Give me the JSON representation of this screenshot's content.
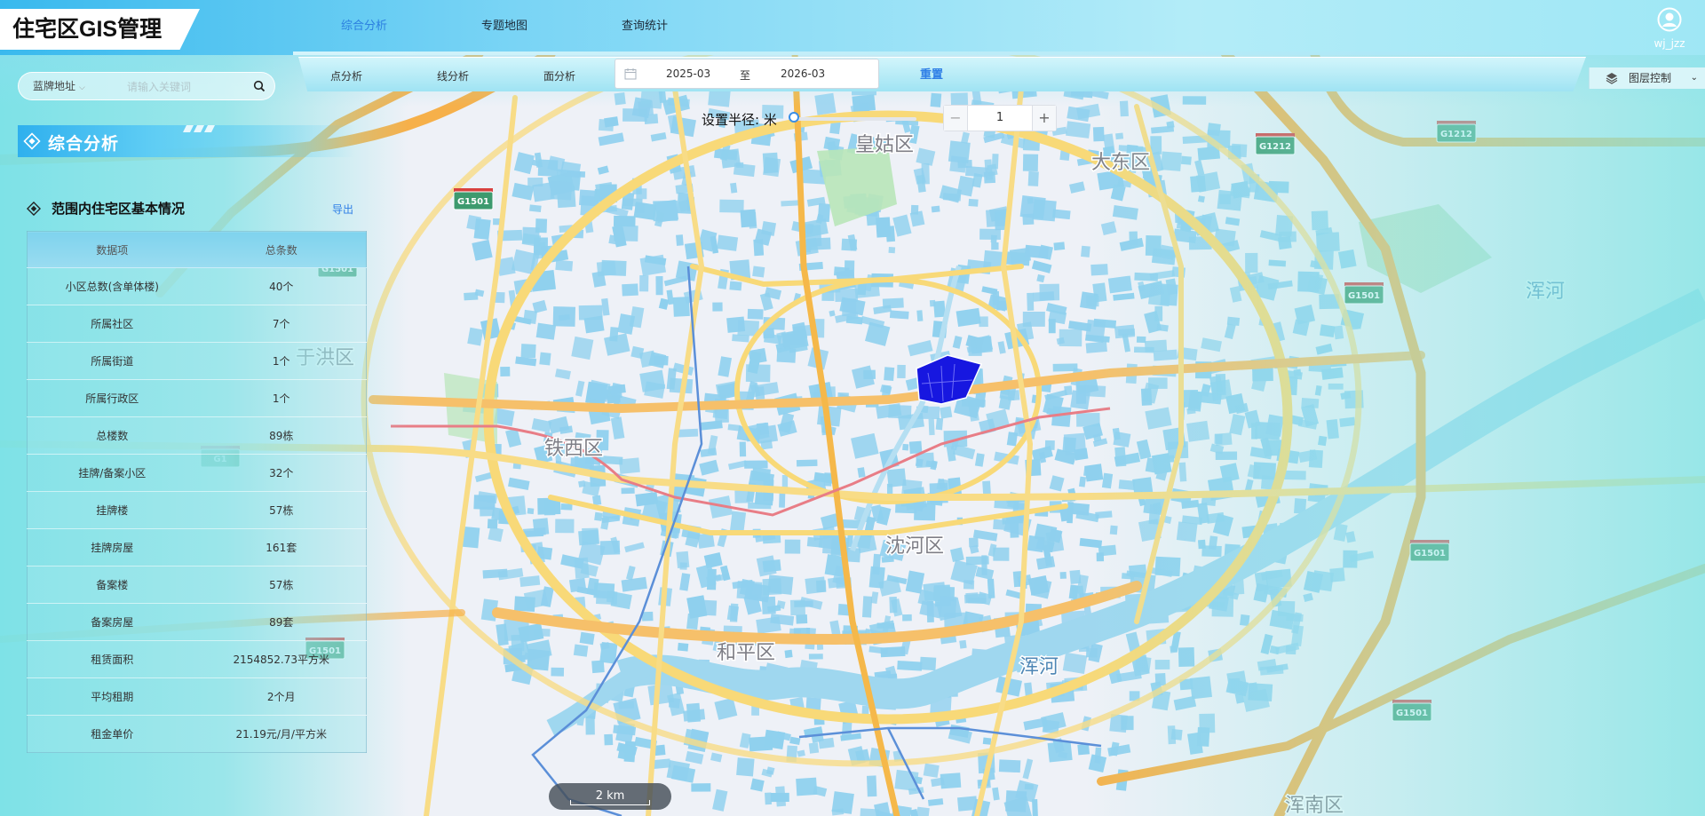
{
  "app": {
    "title": "住宅区GIS管理"
  },
  "header": {
    "tabs": [
      {
        "label": "综合分析",
        "active": true
      },
      {
        "label": "专题地图",
        "active": false
      },
      {
        "label": "查询统计",
        "active": false
      }
    ],
    "user": {
      "name": "wj_jzz",
      "icon": "user-icon"
    }
  },
  "toolbar": {
    "buttons": [
      {
        "label": "点分析"
      },
      {
        "label": "线分析"
      },
      {
        "label": "面分析"
      }
    ],
    "date_range": {
      "start": "2025-03",
      "separator": "至",
      "end": "2026-03",
      "icon": "calendar-icon"
    },
    "reset_label": "重置"
  },
  "layer_control": {
    "label": "图层控制",
    "icon": "layers-icon"
  },
  "search": {
    "type_selected": "蓝牌地址",
    "placeholder": "请输入关键词",
    "icon": "search-icon"
  },
  "radius": {
    "label": "设置半径: 米",
    "slider_value": 0,
    "value": "1",
    "minus": "−",
    "plus": "+"
  },
  "panel": {
    "title": "综合分析",
    "section_title": "范围内住宅区基本情况",
    "export_label": "导出",
    "table": {
      "headers": [
        "数据项",
        "总条数"
      ],
      "rows": [
        [
          "小区总数(含单体楼)",
          "40个"
        ],
        [
          "所属社区",
          "7个"
        ],
        [
          "所属街道",
          "1个"
        ],
        [
          "所属行政区",
          "1个"
        ],
        [
          "总楼数",
          "89栋"
        ],
        [
          "挂牌/备案小区",
          "32个"
        ],
        [
          "挂牌楼",
          "57栋"
        ],
        [
          "挂牌房屋",
          "161套"
        ],
        [
          "备案楼",
          "57栋"
        ],
        [
          "备案房屋",
          "89套"
        ],
        [
          "租赁面积",
          "2154852.73平方米"
        ],
        [
          "平均租期",
          "2个月"
        ],
        [
          "租金单价",
          "21.19元/月/平方米"
        ]
      ]
    }
  },
  "map": {
    "labels": [
      "皇姑区",
      "大东区",
      "于洪区",
      "铁西区",
      "沈河区",
      "和平区",
      "浑河",
      "浑河",
      "浑南区"
    ],
    "road_shields": [
      "G1501",
      "G1212",
      "G1212",
      "G1501",
      "G1",
      "G1501",
      "G1501",
      "G1501",
      "G1501"
    ],
    "scale_label": "2 km",
    "colors": {
      "highlight": "#1717e0",
      "building": "#8fd0ee",
      "road": "#f8d978",
      "ring_road": "#f5b84a",
      "rail": "#e87d86"
    }
  }
}
